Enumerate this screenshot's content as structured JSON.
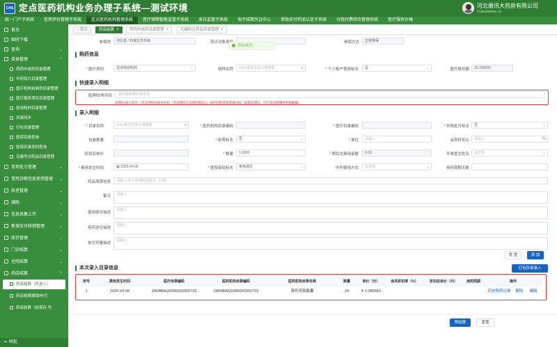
{
  "header": {
    "logo_text": "CHS",
    "title": "定点医药机构业务办理子系统—测试环境",
    "user_name": "河北缴讯大药房有限公司",
    "user_id": "P1304092040_01"
  },
  "nav": [
    "统一门户子系统",
    "信用评价管理子系统",
    "定点医药机构管理系统",
    "医疗保障智能监管子系统",
    "床位监管子系统",
    "电子结算凭证中心",
    "单独支付药品认定子系统",
    "分租付费综合管理系统",
    "医疗服务价格"
  ],
  "sidebar": {
    "items": [
      {
        "label": "首页",
        "chev": ""
      },
      {
        "label": "图时下载",
        "chev": ""
      },
      {
        "label": "查询",
        "chev": "⌄"
      },
      {
        "label": "目录管理",
        "chev": "⌃"
      }
    ],
    "sub_items": [
      "西药中成药目录管理",
      "中药饮片目录管理",
      "医疗机构自制剂目录管理",
      "医疗服务项目目录管理",
      "医用耗材目录管理",
      "目录同步",
      "打包目录管理",
      "医保目录查询",
      "医保目录类别查询",
      "无编号诊药品目录管理"
    ],
    "items2": [
      {
        "label": "常用处方管理",
        "chev": "⌄"
      },
      {
        "label": "常用诊断信息使用管理",
        "chev": "⌄"
      },
      {
        "label": "科室管理",
        "chev": "⌄"
      },
      {
        "label": "辅助",
        "chev": "⌄"
      },
      {
        "label": "信息采集上传",
        "chev": "⌄"
      },
      {
        "label": "新增支付核销管理",
        "chev": "⌄"
      },
      {
        "label": "库存管理",
        "chev": "⌄"
      },
      {
        "label": "门诊结算",
        "chev": "⌄"
      },
      {
        "label": "住院结算",
        "chev": "⌄"
      },
      {
        "label": "药店结算",
        "chev": "⌃"
      }
    ],
    "sub_items2": [
      "药店结算（先进入）",
      "药店结算撤销/补打",
      "药店结算（加保存-先"
    ],
    "collapse": "收起"
  },
  "tabs": [
    "首页",
    "药店结算",
    "西药中成药目录管理",
    "无编码诊药品目录管理"
  ],
  "toast": "添加成功",
  "top_row": {
    "f1_label": "参保地",
    "f1": "河北省 / 石家庄市本级",
    "f2_label": "就诊对象身份",
    "f3_label": "参保方式",
    "f3": "正常参保"
  },
  "purchase": {
    "title": "购药信息",
    "medical_type_label": "医疗类别",
    "medical_type": "选点药店购药",
    "disease_label": "病种名称",
    "disease_ph": "enter或点击放大镜搜索",
    "personal_label": "个人账户使用标志",
    "personal": "是",
    "total_label": "医疗费总额",
    "total": "26.150000"
  },
  "quick": {
    "title": "快速录入明细",
    "code_label": "追溯码/条形码",
    "code_ph": "请扫描追溯码/条形码",
    "hint": "追溯码/录入提示：[无追溯码扫描条形码（无追溯码与追溯码相同）]，按扫码枪选择或者扫描（如需追溯码，可在商品明细中单独编辑）"
  },
  "entry": {
    "title": "录入明细",
    "catalog_code_label": "目录名称",
    "catalog_code_ph": "enter或点击放大镜搜索",
    "med_code_label": "医药机构目录编码",
    "medins_code_label": "医疗目录编码",
    "out_flag_label": "外购处方标志",
    "out_flag": "否",
    "pack_label": "包装数量",
    "split_label": "拆零标志",
    "split": "否",
    "unit_label": "单位",
    "unit_ph": "请输入",
    "discount_label": "会员折扣比",
    "discount_ph": "请输入",
    "pct": "%",
    "after_price_label": "折扣后单价",
    "qty_label": "数量",
    "qty": "1.0000",
    "fee_label": "明目总费用金额",
    "fee": "0.00",
    "doctor_label": "开单医生姓名",
    "doctor_ph": "请选择",
    "date_label": "费用发生时间",
    "date": "2025-04-09",
    "dept_label": "医院审批标志",
    "dept": "审批通过",
    "tcm_label": "中药使用方式",
    "tcm_ph": "请选择",
    "period_label": "用药周期天数",
    "note_label": "药品溯源信息",
    "note_ph": "请输入(多个追溯码请填写 , 分隔)",
    "remark_label": "备注",
    "remark_ph": "请输入",
    "usage_label": "使用频次描述",
    "usage_ph": "请输入",
    "route_label": "用药途径描述",
    "route_ph": "请输入",
    "dose_label": "单次剂量描述",
    "dose_ph": "请输入",
    "reset": "重 置",
    "add": "添 加"
  },
  "records": {
    "title": "本次录入目录信息",
    "print_btn": "打包目录录入",
    "columns": [
      "序号",
      "费用发生时间",
      "医疗目录编码",
      "医药机构目录编码",
      "医药机构目录名称",
      "数量",
      "单价（元）",
      "会员折扣率（%）",
      "折扣后单价（元）",
      "用药周期",
      "操作"
    ],
    "rows": [
      {
        "no": "1",
        "date": "2025-04-09",
        "code": "ZA04BAQ0396020302729",
        "med_code": "ZA04BAQ0396020302729",
        "name": "清开灵软胶囊",
        "qty": "24",
        "price": "¥ 1.089583",
        "discount": "",
        "after": "",
        "period": "",
        "op1": "历史购药记录",
        "op2": "删除",
        "op3": "编辑"
      }
    ]
  },
  "footer": {
    "settle": "预结算",
    "reset": "重置"
  }
}
